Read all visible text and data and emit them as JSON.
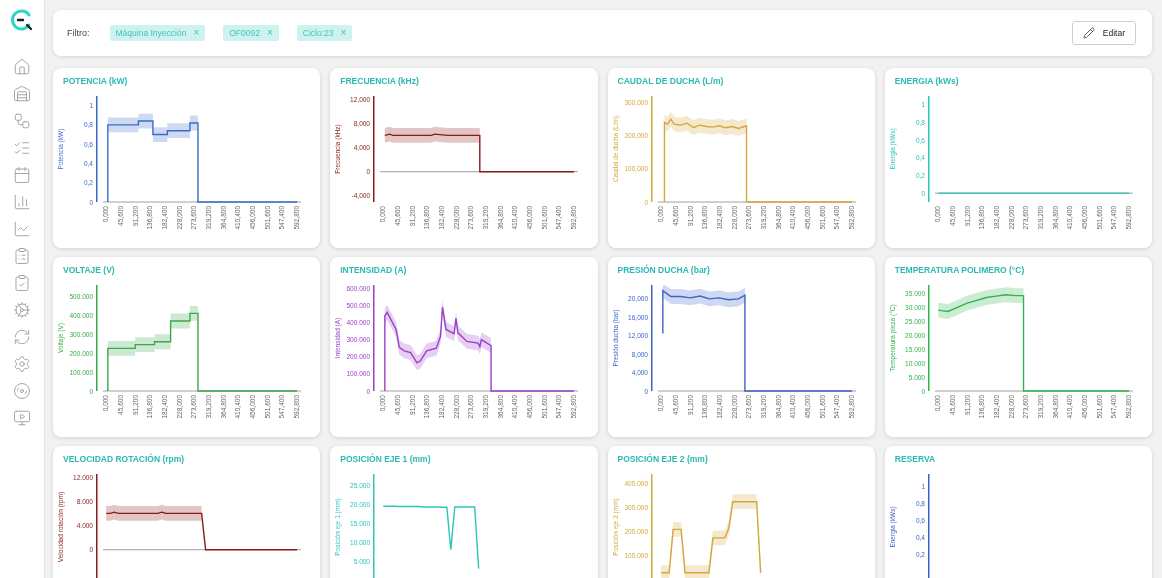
{
  "filter": {
    "label": "Filtro:",
    "chips": [
      {
        "text": "Máquina Inyección",
        "remove": "×"
      },
      {
        "text": "OF0092",
        "remove": "×"
      },
      {
        "text": "Ciclo:23",
        "remove": "×"
      }
    ],
    "edit_button": {
      "label": "Editar"
    }
  },
  "cards": [
    {
      "title": "POTENCIA (kW)",
      "color": "#3a6bc9",
      "range_band": true,
      "chart_data": {
        "type": "line",
        "ylabel": "Potencia (kW)",
        "xlim": [
          -10,
          605
        ],
        "ylim": [
          0,
          1.1
        ],
        "x": [
          5,
          5,
          100,
          100,
          145,
          145,
          190,
          190,
          260,
          260,
          285,
          285,
          592.8
        ],
        "xticks": [
          {
            "value": 0,
            "label": "0,000"
          },
          {
            "value": 45.6,
            "label": "45,600"
          },
          {
            "value": 91.2,
            "label": "91,200"
          },
          {
            "value": 136.8,
            "label": "136,800"
          },
          {
            "value": 182.4,
            "label": "182,400"
          },
          {
            "value": 228,
            "label": "228,000"
          },
          {
            "value": 273.6,
            "label": "273,600"
          },
          {
            "value": 319.2,
            "label": "319,200"
          },
          {
            "value": 364.8,
            "label": "364,800"
          },
          {
            "value": 410.4,
            "label": "410,400"
          },
          {
            "value": 456,
            "label": "456,000"
          },
          {
            "value": 501.6,
            "label": "501,600"
          },
          {
            "value": 547.4,
            "label": "547,400"
          },
          {
            "value": 592.8,
            "label": "592,800"
          }
        ],
        "yticks": [
          {
            "value": 0,
            "label": "0"
          },
          {
            "value": 0.2,
            "label": "0,2"
          },
          {
            "value": 0.4,
            "label": "0,4"
          },
          {
            "value": 0.6,
            "label": "0,6"
          },
          {
            "value": 0.8,
            "label": "0,8"
          },
          {
            "value": 1,
            "label": "1"
          }
        ],
        "series": [
          {
            "color": "#3a6bc9",
            "values": [
              0,
              0.8,
              0.8,
              0.84,
              0.84,
              0.7,
              0.7,
              0.74,
              0.74,
              0.82,
              0.82,
              0,
              0
            ]
          }
        ]
      }
    },
    {
      "title": "FRECUENCIA (kHz)",
      "color": "#8b1a1a",
      "range_band": true,
      "chart_data": {
        "type": "line",
        "ylabel": "Frecuencia (kHz)",
        "xlim": [
          -10,
          605
        ],
        "ylim": [
          -5,
          12.5
        ],
        "x": [
          5,
          20,
          30,
          150,
          160,
          200,
          300,
          300,
          592.8
        ],
        "xticks": [
          {
            "value": 0,
            "label": "0,000"
          },
          {
            "value": 45.6,
            "label": "45,600"
          },
          {
            "value": 91.2,
            "label": "91,200"
          },
          {
            "value": 136.8,
            "label": "136,800"
          },
          {
            "value": 182.4,
            "label": "182,400"
          },
          {
            "value": 228,
            "label": "228,000"
          },
          {
            "value": 273.6,
            "label": "273,600"
          },
          {
            "value": 319.2,
            "label": "319,200"
          },
          {
            "value": 364.8,
            "label": "364,800"
          },
          {
            "value": 410.4,
            "label": "410,400"
          },
          {
            "value": 456,
            "label": "456,000"
          },
          {
            "value": 501.6,
            "label": "501,600"
          },
          {
            "value": 547.4,
            "label": "547,400"
          },
          {
            "value": 592.8,
            "label": "592,800"
          }
        ],
        "yticks": [
          {
            "value": -4,
            "label": "-4,000"
          },
          {
            "value": 0,
            "label": "0"
          },
          {
            "value": 4,
            "label": "4,000"
          },
          {
            "value": 8,
            "label": "8,000"
          },
          {
            "value": 12,
            "label": "12,000"
          }
        ],
        "series": [
          {
            "color": "#8b1a1a",
            "values": [
              6,
              6.2,
              6,
              6,
              6.2,
              6,
              6,
              0,
              0
            ]
          }
        ]
      }
    },
    {
      "title": "CAUDAL DE DUCHA (L/m)",
      "color": "#d4a73a",
      "range_band": true,
      "chart_data": {
        "type": "line",
        "ylabel": "Caudal de ducha (L/m)",
        "xlim": [
          -10,
          605
        ],
        "ylim": [
          0,
          320
        ],
        "x": [
          10,
          10,
          20,
          30,
          40,
          60,
          80,
          100,
          120,
          140,
          160,
          180,
          200,
          220,
          240,
          265,
          265,
          592.8
        ],
        "xticks": [
          {
            "value": 0,
            "label": "0,000"
          },
          {
            "value": 45.6,
            "label": "45,600"
          },
          {
            "value": 91.2,
            "label": "91,200"
          },
          {
            "value": 136.8,
            "label": "136,800"
          },
          {
            "value": 182.4,
            "label": "182,400"
          },
          {
            "value": 228,
            "label": "228,000"
          },
          {
            "value": 273.6,
            "label": "273,600"
          },
          {
            "value": 319.2,
            "label": "319,200"
          },
          {
            "value": 364.8,
            "label": "364,800"
          },
          {
            "value": 410.4,
            "label": "410,400"
          },
          {
            "value": 456,
            "label": "456,000"
          },
          {
            "value": 501.6,
            "label": "501,600"
          },
          {
            "value": 547.4,
            "label": "547,400"
          },
          {
            "value": 592.8,
            "label": "592,800"
          }
        ],
        "yticks": [
          {
            "value": 0,
            "label": "0"
          },
          {
            "value": 100,
            "label": "100,000"
          },
          {
            "value": 200,
            "label": "200,000"
          },
          {
            "value": 300,
            "label": "300,000"
          }
        ],
        "series": [
          {
            "color": "#d4a73a",
            "values": [
              0,
              240,
              235,
              250,
              235,
              232,
              238,
              225,
              232,
              228,
              226,
              230,
              224,
              228,
              222,
              230,
              0,
              0
            ]
          }
        ]
      }
    },
    {
      "title": "ENERGIA (kWs)",
      "color": "#2ec4b6",
      "range_band": false,
      "chart_data": {
        "type": "line",
        "ylabel": "Energia (kWs)",
        "xlim": [
          -10,
          605
        ],
        "ylim": [
          -0.1,
          1.1
        ],
        "x": [
          0,
          592.8
        ],
        "xticks": [
          {
            "value": 0,
            "label": "0,000"
          },
          {
            "value": 45.6,
            "label": "45,600"
          },
          {
            "value": 91.2,
            "label": "91,200"
          },
          {
            "value": 136.8,
            "label": "136,800"
          },
          {
            "value": 182.4,
            "label": "182,400"
          },
          {
            "value": 228,
            "label": "228,000"
          },
          {
            "value": 273.6,
            "label": "273,600"
          },
          {
            "value": 319.2,
            "label": "319,200"
          },
          {
            "value": 364.8,
            "label": "364,800"
          },
          {
            "value": 410.4,
            "label": "410,400"
          },
          {
            "value": 456,
            "label": "456,000"
          },
          {
            "value": 501.6,
            "label": "501,600"
          },
          {
            "value": 547.4,
            "label": "547,400"
          },
          {
            "value": 592.8,
            "label": "592,800"
          }
        ],
        "yticks": [
          {
            "value": 0,
            "label": "0"
          },
          {
            "value": 0.2,
            "label": "0,2"
          },
          {
            "value": 0.4,
            "label": "0,4"
          },
          {
            "value": 0.6,
            "label": "0,6"
          },
          {
            "value": 0.8,
            "label": "0,8"
          },
          {
            "value": 1,
            "label": "1"
          }
        ],
        "series": [
          {
            "color": "#2ec4b6",
            "values": [
              0,
              0
            ]
          }
        ]
      }
    },
    {
      "title": "VOLTAJE (V)",
      "color": "#3aa84a",
      "range_band": true,
      "chart_data": {
        "type": "line",
        "ylabel": "Voltaje (V)",
        "xlim": [
          -10,
          605
        ],
        "ylim": [
          0,
          560000
        ],
        "x": [
          5,
          5,
          90,
          90,
          150,
          150,
          200,
          200,
          260,
          260,
          285,
          285,
          592.8
        ],
        "xticks": [
          {
            "value": 0,
            "label": "0,000"
          },
          {
            "value": 45.6,
            "label": "45,600"
          },
          {
            "value": 91.2,
            "label": "91,200"
          },
          {
            "value": 136.8,
            "label": "136,800"
          },
          {
            "value": 182.4,
            "label": "182,400"
          },
          {
            "value": 228,
            "label": "228,000"
          },
          {
            "value": 273.6,
            "label": "273,600"
          },
          {
            "value": 319.2,
            "label": "319,200"
          },
          {
            "value": 364.8,
            "label": "364,800"
          },
          {
            "value": 410.4,
            "label": "410,400"
          },
          {
            "value": 456,
            "label": "456,000"
          },
          {
            "value": 501.6,
            "label": "501,600"
          },
          {
            "value": 547.4,
            "label": "547,400"
          },
          {
            "value": 592.8,
            "label": "592,800"
          }
        ],
        "yticks": [
          {
            "value": 0,
            "label": "0"
          },
          {
            "value": 100000,
            "label": "100.000"
          },
          {
            "value": 200000,
            "label": "200.000"
          },
          {
            "value": 300000,
            "label": "300.000"
          },
          {
            "value": 400000,
            "label": "400.000"
          },
          {
            "value": 500000,
            "label": "500.000"
          }
        ],
        "series": [
          {
            "color": "#3aa84a",
            "values": [
              0,
              225000,
              225000,
              245000,
              245000,
              260000,
              260000,
              370000,
              370000,
              410000,
              410000,
              0,
              0
            ]
          }
        ]
      }
    },
    {
      "title": "INTENSIDAD (A)",
      "color": "#9b3fc9",
      "range_band": true,
      "chart_data": {
        "type": "line",
        "ylabel": "Intensidad (A)",
        "xlim": [
          -10,
          605
        ],
        "ylim": [
          0,
          620000
        ],
        "x": [
          5,
          5,
          12,
          40,
          50,
          65,
          85,
          105,
          115,
          135,
          165,
          178,
          184,
          195,
          220,
          226,
          232,
          260,
          295,
          300,
          305,
          335,
          335,
          592.8
        ],
        "xticks": [
          {
            "value": 0,
            "label": "0,000"
          },
          {
            "value": 45.6,
            "label": "45,600"
          },
          {
            "value": 91.2,
            "label": "91,200"
          },
          {
            "value": 136.8,
            "label": "136,800"
          },
          {
            "value": 182.4,
            "label": "182,400"
          },
          {
            "value": 228,
            "label": "228,000"
          },
          {
            "value": 273.6,
            "label": "273,600"
          },
          {
            "value": 319.2,
            "label": "319,200"
          },
          {
            "value": 364.8,
            "label": "364,800"
          },
          {
            "value": 410.4,
            "label": "410,400"
          },
          {
            "value": 456,
            "label": "456,000"
          },
          {
            "value": 501.6,
            "label": "501,600"
          },
          {
            "value": 547.4,
            "label": "547,400"
          },
          {
            "value": 592.8,
            "label": "592,800"
          }
        ],
        "yticks": [
          {
            "value": 0,
            "label": "0"
          },
          {
            "value": 100000,
            "label": "100.000"
          },
          {
            "value": 200000,
            "label": "200.000"
          },
          {
            "value": 300000,
            "label": "300.000"
          },
          {
            "value": 400000,
            "label": "400.000"
          },
          {
            "value": 500000,
            "label": "500.000"
          },
          {
            "value": 600000,
            "label": "600.000"
          }
        ],
        "series": [
          {
            "color": "#9b3fc9",
            "values": [
              0,
              440000,
              460000,
              360000,
              255000,
              235000,
              225000,
              165000,
              175000,
              235000,
              250000,
              320000,
              490000,
              360000,
              335000,
              425000,
              340000,
              290000,
              280000,
              260000,
              300000,
              265000,
              0,
              0
            ]
          }
        ]
      }
    },
    {
      "title": "PRESIÓN DUCHA (bar)",
      "color": "#3a62c9",
      "range_band": true,
      "chart_data": {
        "type": "line",
        "ylabel": "Presión ducha (bar)",
        "xlim": [
          -10,
          605
        ],
        "ylim": [
          0,
          23
        ],
        "x": [
          5,
          5,
          10,
          30,
          60,
          90,
          120,
          150,
          180,
          210,
          240,
          255,
          260,
          260,
          592.8
        ],
        "xticks": [
          {
            "value": 0,
            "label": "0,000"
          },
          {
            "value": 45.6,
            "label": "45,600"
          },
          {
            "value": 91.2,
            "label": "91,200"
          },
          {
            "value": 136.8,
            "label": "136,800"
          },
          {
            "value": 182.4,
            "label": "182,400"
          },
          {
            "value": 228,
            "label": "228,000"
          },
          {
            "value": 273.6,
            "label": "273,600"
          },
          {
            "value": 319.2,
            "label": "319,200"
          },
          {
            "value": 364.8,
            "label": "364,800"
          },
          {
            "value": 410.4,
            "label": "410,400"
          },
          {
            "value": 456,
            "label": "456,000"
          },
          {
            "value": 501.6,
            "label": "501,600"
          },
          {
            "value": 547.4,
            "label": "547,400"
          },
          {
            "value": 592.8,
            "label": "592,800"
          }
        ],
        "yticks": [
          {
            "value": 0,
            "label": "0"
          },
          {
            "value": 4,
            "label": "4,000"
          },
          {
            "value": 8,
            "label": "8,000"
          },
          {
            "value": 12,
            "label": "12,000"
          },
          {
            "value": 16,
            "label": "16,000"
          },
          {
            "value": 20,
            "label": "20,000"
          }
        ],
        "series": [
          {
            "color": "#3a62c9",
            "values": [
              12.5,
              21.8,
              21.5,
              20.5,
              20.5,
              20.2,
              20.6,
              20,
              20.2,
              19.8,
              20,
              20.6,
              20.8,
              0,
              0
            ]
          }
        ]
      }
    },
    {
      "title": "TEMPERATURA POLIMERO (°C)",
      "color": "#2fb34a",
      "range_band": true,
      "chart_data": {
        "type": "line",
        "ylabel": "Temperatura pieza (°C)",
        "xlim": [
          -10,
          605
        ],
        "ylim": [
          0,
          38000
        ],
        "x": [
          0,
          10,
          30,
          60,
          90,
          120,
          150,
          180,
          210,
          240,
          265,
          265,
          592.8
        ],
        "xticks": [
          {
            "value": 0,
            "label": "0,000"
          },
          {
            "value": 45.6,
            "label": "45,600"
          },
          {
            "value": 91.2,
            "label": "91,200"
          },
          {
            "value": 136.8,
            "label": "136,800"
          },
          {
            "value": 182.4,
            "label": "182,400"
          },
          {
            "value": 228,
            "label": "228,000"
          },
          {
            "value": 273.6,
            "label": "273,600"
          },
          {
            "value": 319.2,
            "label": "319,200"
          },
          {
            "value": 364.8,
            "label": "364,800"
          },
          {
            "value": 410.4,
            "label": "410,400"
          },
          {
            "value": 456,
            "label": "456,000"
          },
          {
            "value": 501.6,
            "label": "501,600"
          },
          {
            "value": 547.4,
            "label": "547,400"
          },
          {
            "value": 592.8,
            "label": "592,800"
          }
        ],
        "yticks": [
          {
            "value": 0,
            "label": "0"
          },
          {
            "value": 5000,
            "label": "5.000"
          },
          {
            "value": 10000,
            "label": "10.000"
          },
          {
            "value": 15000,
            "label": "15.000"
          },
          {
            "value": 20000,
            "label": "20.000"
          },
          {
            "value": 25000,
            "label": "25.000"
          },
          {
            "value": 30000,
            "label": "30.000"
          },
          {
            "value": 35000,
            "label": "35.000"
          }
        ],
        "series": [
          {
            "color": "#2fb34a",
            "values": [
              29000,
              28800,
              28500,
              30000,
              31500,
              32500,
              33500,
              34000,
              34500,
              34200,
              34200,
              0,
              0
            ]
          }
        ]
      }
    },
    {
      "title": "VELOCIDAD ROTACIÓN (rpm)",
      "color": "#8b1a1a",
      "range_band": true,
      "chart_data": {
        "type": "line",
        "ylabel": "Velocidad rotación (rpm)",
        "ylim": [
          -5000,
          12500
        ],
        "categories": [
          null,
          null,
          null,
          null,
          null,
          null,
          null,
          null,
          null,
          null,
          null,
          null,
          null,
          null,
          null,
          null,
          null,
          null,
          null,
          null,
          null,
          null,
          null,
          null,
          null,
          null,
          null,
          null,
          null,
          null,
          null,
          null,
          null,
          null,
          null,
          null,
          null,
          null,
          null,
          null,
          null,
          null,
          null,
          null,
          null,
          null,
          null,
          null,
          null
        ],
        "yticks": [
          {
            "value": 0,
            "label": "0"
          },
          {
            "value": 4000,
            "label": "4.000"
          },
          {
            "value": 8000,
            "label": "8.000"
          },
          {
            "value": 12000,
            "label": "12.000"
          }
        ],
        "series": [
          {
            "color": "#8b1a1a",
            "values": [
              6000,
              6000,
              6200,
              6000,
              6000,
              6000,
              6000,
              6000,
              6000,
              6000,
              6000,
              6000,
              6000,
              6000,
              6200,
              6000,
              6000,
              6000,
              6000,
              6000,
              6000,
              6000,
              6000,
              6000,
              6000,
              0,
              0,
              0,
              0,
              0,
              0,
              0,
              0,
              0,
              0,
              0,
              0,
              0,
              0,
              0,
              0,
              0,
              0,
              0,
              0,
              0,
              0,
              0,
              0
            ]
          }
        ]
      }
    },
    {
      "title": "POSICIÓN EJE 1 (mm)",
      "color": "#2ec4b6",
      "range_band": false,
      "chart_data": {
        "type": "line",
        "ylabel": "Posición eje 1 (mm)",
        "ylim": [
          0,
          28000
        ],
        "categories": [
          null,
          null,
          null,
          null,
          null,
          null,
          null,
          null,
          null,
          null,
          null,
          null,
          null,
          null,
          null,
          null,
          null,
          null,
          null,
          null,
          null,
          null,
          null,
          null,
          null
        ],
        "yticks": [
          {
            "value": 5000,
            "label": "5.000"
          },
          {
            "value": 10000,
            "label": "10.000"
          },
          {
            "value": 15000,
            "label": "15.000"
          },
          {
            "value": 20000,
            "label": "20.000"
          },
          {
            "value": 25000,
            "label": "25.000"
          }
        ],
        "series": [
          {
            "color": "#2ec4b6",
            "values": [
              19500,
              19500,
              19500,
              19500,
              19400,
              19400,
              19400,
              19400,
              19400,
              19400,
              19300,
              19300,
              19300,
              19300,
              19300,
              19200,
              19200,
              8000,
              19300,
              19300,
              19300,
              19300,
              19300,
              19300,
              3000
            ]
          }
        ]
      }
    },
    {
      "title": "POSICIÓN EJE 2 (mm)",
      "color": "#d4a73a",
      "range_band": true,
      "chart_data": {
        "type": "line",
        "ylabel": "Posición eje 2 (mm)",
        "ylim": [
          0,
          440000
        ],
        "categories": [
          null,
          null,
          null,
          null,
          null,
          null,
          null,
          null,
          null,
          null,
          null,
          null,
          null,
          null,
          null,
          null,
          null,
          null,
          null,
          null,
          null,
          null,
          null,
          null,
          null,
          null
        ],
        "yticks": [
          {
            "value": 100000,
            "label": "100.000"
          },
          {
            "value": 200000,
            "label": "200.000"
          },
          {
            "value": 300000,
            "label": "300.000"
          },
          {
            "value": 400000,
            "label": "400.000"
          }
        ],
        "series": [
          {
            "color": "#d4a73a",
            "values": [
              30000,
              30000,
              30000,
              210000,
              210000,
              210000,
              30000,
              30000,
              30000,
              30000,
              30000,
              30000,
              30000,
              175000,
              175000,
              175000,
              175000,
              215000,
              325000,
              325000,
              325000,
              325000,
              325000,
              325000,
              325000,
              30000
            ]
          }
        ]
      }
    },
    {
      "title": "RESERVA",
      "color": "#3a62c9",
      "axis": {
        "label": "Energia (kWs)",
        "ticks": [
          "1",
          "0,8",
          "0,6",
          "0,4",
          "0,2"
        ]
      }
    }
  ]
}
